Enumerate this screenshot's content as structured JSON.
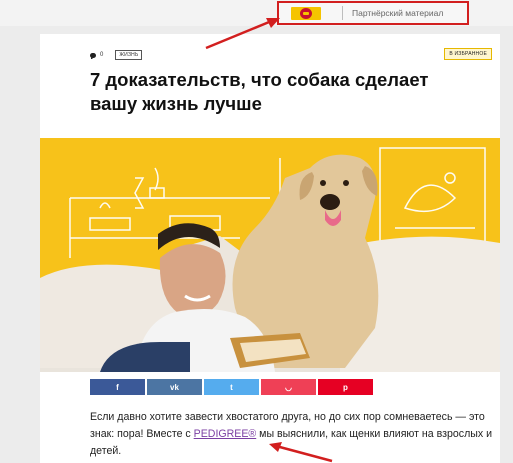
{
  "header": {
    "partner_label": "Партнёрский материал",
    "partner_logo": "pedigree-logo"
  },
  "article": {
    "comment_count": "0",
    "category": "ЖИЗНЬ",
    "favorite_label": "В ИЗБРАННОЕ",
    "title": "7 доказательств, что собака сделает вашу жизнь лучше",
    "hero_image": "man-with-labrador-on-sofa",
    "share_buttons": [
      {
        "name": "facebook",
        "glyph": "f"
      },
      {
        "name": "vk",
        "glyph": "vk"
      },
      {
        "name": "twitter",
        "glyph": "t"
      },
      {
        "name": "pocket",
        "glyph": "◡"
      },
      {
        "name": "pinterest",
        "glyph": "p"
      }
    ],
    "lead_before": "Если давно хотите завести хвостатого друга, но до сих пор сомневаетесь — это знак: пора! Вместе с ",
    "lead_brand": "PEDIGREE®",
    "lead_after": " мы выяснили, как щенки влияют на взрослых и детей."
  },
  "colors": {
    "annotation": "#d21f1f",
    "hero_background": "#f7c21a",
    "brand_link": "#7b3fa3"
  }
}
